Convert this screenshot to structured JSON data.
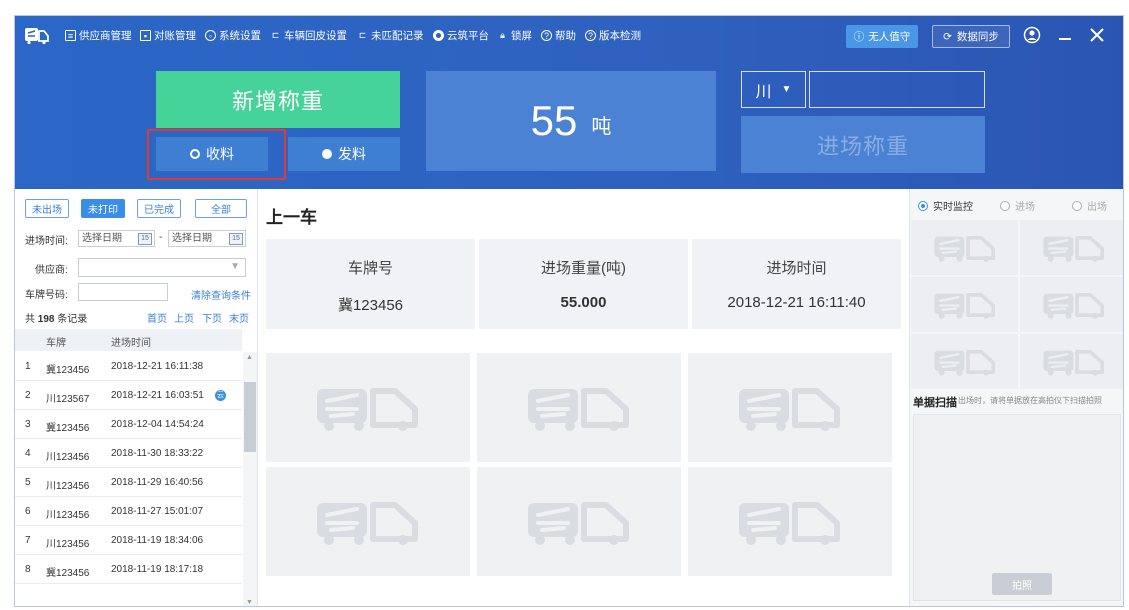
{
  "header": {
    "menu": [
      {
        "label": "供应商管理",
        "icon": "list-icon"
      },
      {
        "label": "对账管理",
        "icon": "reconcile-icon"
      },
      {
        "label": "系统设置",
        "icon": "settings-icon"
      },
      {
        "label": "车辆回皮设置",
        "icon": "truck-icon"
      },
      {
        "label": "未匹配记录",
        "icon": "truck-icon"
      },
      {
        "label": "云筑平台",
        "icon": "cloud-platform-icon"
      },
      {
        "label": "锁屏",
        "icon": "lock-icon"
      },
      {
        "label": "帮助",
        "icon": "help-icon"
      },
      {
        "label": "版本检测",
        "icon": "version-icon"
      }
    ],
    "unmanned_label": "无人值守",
    "sync_label": "数据同步"
  },
  "weighing": {
    "add_weigh_label": "新增称重",
    "mode_receive_label": "收料",
    "mode_send_label": "发料",
    "weight_value": "55",
    "weight_unit": "吨",
    "province": "川",
    "plate_input_value": "",
    "entry_weigh_label": "进场称重"
  },
  "filters": {
    "tabs": [
      "未出场",
      "未打印",
      "已完成",
      "全部"
    ],
    "active_tab": "未打印",
    "entry_time_label": "进场时间:",
    "date_placeholder_start": "选择日期",
    "date_placeholder_end": "选择日期",
    "date_separator": "-",
    "calendar_day": "15",
    "supplier_label": "供应商:",
    "plate_label": "车牌号码:",
    "clear_label": "清除查询条件",
    "count_prefix": "共",
    "count_value": "198",
    "count_suffix": "条记录",
    "pager": [
      "首页",
      "上页",
      "下页",
      "末页"
    ]
  },
  "record_list": {
    "columns": [
      "车牌",
      "进场时间"
    ],
    "rows": [
      {
        "index": "1",
        "plate": "冀123456",
        "time": "2018-12-21 16:11:38",
        "badge": ""
      },
      {
        "index": "2",
        "plate": "川123567",
        "time": "2018-12-21 16:03:51",
        "badge": "云"
      },
      {
        "index": "3",
        "plate": "冀123456",
        "time": "2018-12-04 14:54:24",
        "badge": ""
      },
      {
        "index": "4",
        "plate": "川123456",
        "time": "2018-11-30 18:33:22",
        "badge": ""
      },
      {
        "index": "5",
        "plate": "川123456",
        "time": "2018-11-29 16:40:56",
        "badge": ""
      },
      {
        "index": "6",
        "plate": "川123456",
        "time": "2018-11-27 15:01:07",
        "badge": ""
      },
      {
        "index": "7",
        "plate": "川123456",
        "time": "2018-11-19 18:34:06",
        "badge": ""
      },
      {
        "index": "8",
        "plate": "冀123456",
        "time": "2018-11-19 18:17:18",
        "badge": ""
      }
    ]
  },
  "previous_car": {
    "title": "上一车",
    "plate_head": "车牌号",
    "plate_value": "冀123456",
    "weight_head": "进场重量(吨)",
    "weight_value": "55.000",
    "time_head": "进场时间",
    "time_value": "2018-12-21 16:11:40"
  },
  "camera": {
    "options": [
      "实时监控",
      "进场",
      "出场"
    ],
    "selected": "实时监控",
    "scan_title": "单据扫描",
    "scan_hint": "出场时，请将单据放在高拍仪下扫描拍照",
    "capture_label": "拍照"
  },
  "colors": {
    "header_blue": "#2f62c0",
    "accent_green": "#45d39a",
    "highlight_red": "#e53935",
    "link_blue": "#3a7fe0"
  }
}
